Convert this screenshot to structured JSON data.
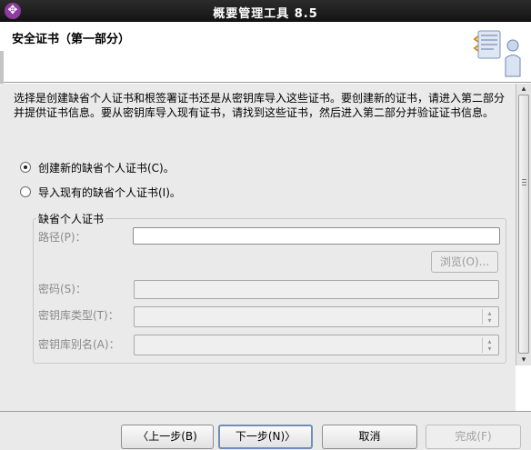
{
  "window": {
    "title": "概要管理工具 8.5",
    "logo_icon": "app-logo-icon"
  },
  "header": {
    "title": "安全证书（第一部分）",
    "icon": "wizard-clipboard-icon"
  },
  "description": "选择是创建缺省个人证书和根签署证书还是从密钥库导入这些证书。要创建新的证书，请进入第二部分并提供证书信息。要从密钥库导入现有证书，请找到这些证书，然后进入第二部分并验证证书信息。",
  "options": {
    "create_label": "创建新的缺省个人证书(C)。",
    "import_label": "导入现有的缺省个人证书(I)。",
    "selected": "create"
  },
  "personal_cert": {
    "group_title": "缺省个人证书",
    "path_label": "路径(P)：",
    "path_value": "",
    "browse_label": "浏览(O)...",
    "password_label": "密码(S)：",
    "keystore_type_label": "密钥库类型(T)：",
    "keystore_alias_label": "密钥库别名(A)："
  },
  "buttons": {
    "back": "〈上一步(B)",
    "next": "下一步(N)〉",
    "cancel": "取消",
    "finish": "完成(F)"
  }
}
